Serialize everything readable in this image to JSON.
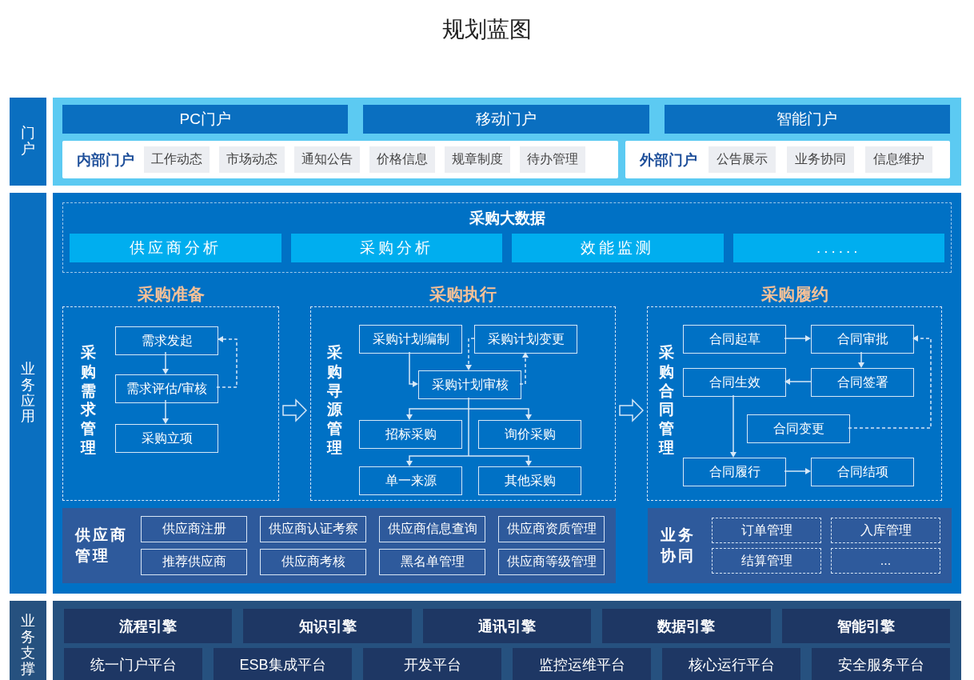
{
  "title": "规划蓝图",
  "portal": {
    "label": "门户",
    "channels": [
      "PC门户",
      "移动门户",
      "智能门户"
    ],
    "internal": {
      "title": "内部门户",
      "items": [
        "工作动态",
        "市场动态",
        "通知公告",
        "价格信息",
        "规章制度",
        "待办管理"
      ]
    },
    "external": {
      "title": "外部门户",
      "items": [
        "公告展示",
        "业务协同",
        "信息维护"
      ]
    }
  },
  "business": {
    "label": "业务应用",
    "big_data": {
      "title": "采购大数据",
      "items": [
        "供应商分析",
        "采购分析",
        "效能监测",
        "......"
      ]
    },
    "stages": [
      {
        "title": "采购准备",
        "side_label": "采购需求管理",
        "nodes": [
          "需求发起",
          "需求评估/审核",
          "采购立项"
        ]
      },
      {
        "title": "采购执行",
        "side_label": "采购寻源管理",
        "nodes": [
          "采购计划编制",
          "采购计划变更",
          "采购计划审核",
          "招标采购",
          "询价采购",
          "单一来源",
          "其他采购"
        ]
      },
      {
        "title": "采购履约",
        "side_label": "采购合同管理",
        "nodes": [
          "合同起草",
          "合同审批",
          "合同生效",
          "合同签署",
          "合同变更",
          "合同履行",
          "合同结项"
        ]
      }
    ],
    "supplier_management": {
      "title": "供应商管理",
      "items": [
        "供应商注册",
        "供应商认证考察",
        "供应商信息查询",
        "供应商资质管理",
        "推荐供应商",
        "供应商考核",
        "黑名单管理",
        "供应商等级管理"
      ]
    },
    "collaboration": {
      "title": "业务协同",
      "items": [
        "订单管理",
        "入库管理",
        "结算管理",
        "..."
      ]
    }
  },
  "support": {
    "label": "业务支撑",
    "engines": [
      "流程引擎",
      "知识引擎",
      "通讯引擎",
      "数据引擎",
      "智能引擎"
    ],
    "platforms": [
      "统一门户平台",
      "ESB集成平台",
      "开发平台",
      "监控运维平台",
      "核心运行平台",
      "安全服务平台"
    ]
  }
}
